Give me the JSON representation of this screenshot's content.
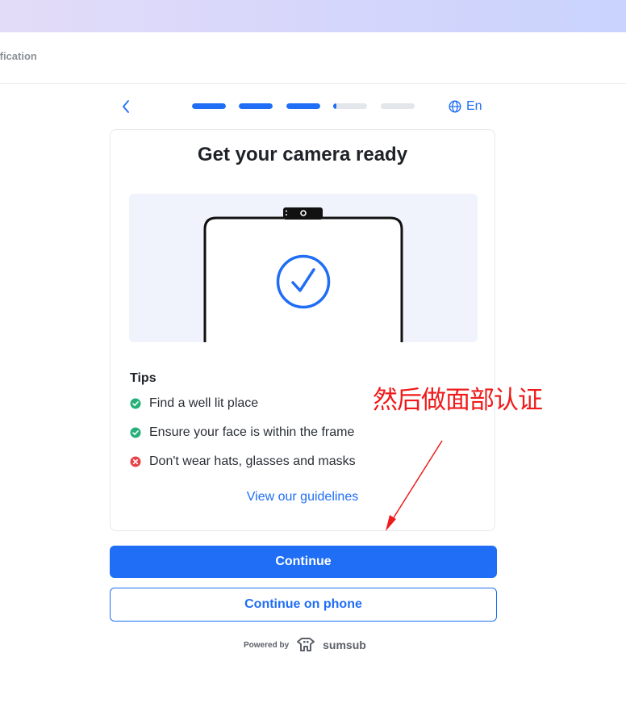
{
  "header": {
    "title": "ification"
  },
  "nav": {
    "language": "En"
  },
  "progress": [
    1,
    1,
    1,
    0.1,
    0
  ],
  "card": {
    "title": "Get your camera ready",
    "tips_title": "Tips",
    "tips": [
      {
        "text": "Find a well lit place",
        "status": "ok"
      },
      {
        "text": "Ensure your face is within the frame",
        "status": "ok"
      },
      {
        "text": "Don't wear hats, glasses and masks",
        "status": "bad"
      }
    ],
    "guidelines_link": "View our guidelines"
  },
  "actions": {
    "continue_label": "Continue",
    "continue_phone_label": "Continue on phone"
  },
  "footer": {
    "powered_by": "Powered by",
    "brand": "sumsub"
  },
  "annotation": {
    "text": "然后做面部认证"
  },
  "colors": {
    "accent": "#1f6ef5",
    "ok": "#27b07a",
    "bad": "#e8434a",
    "annotation": "#ef1b1b"
  }
}
